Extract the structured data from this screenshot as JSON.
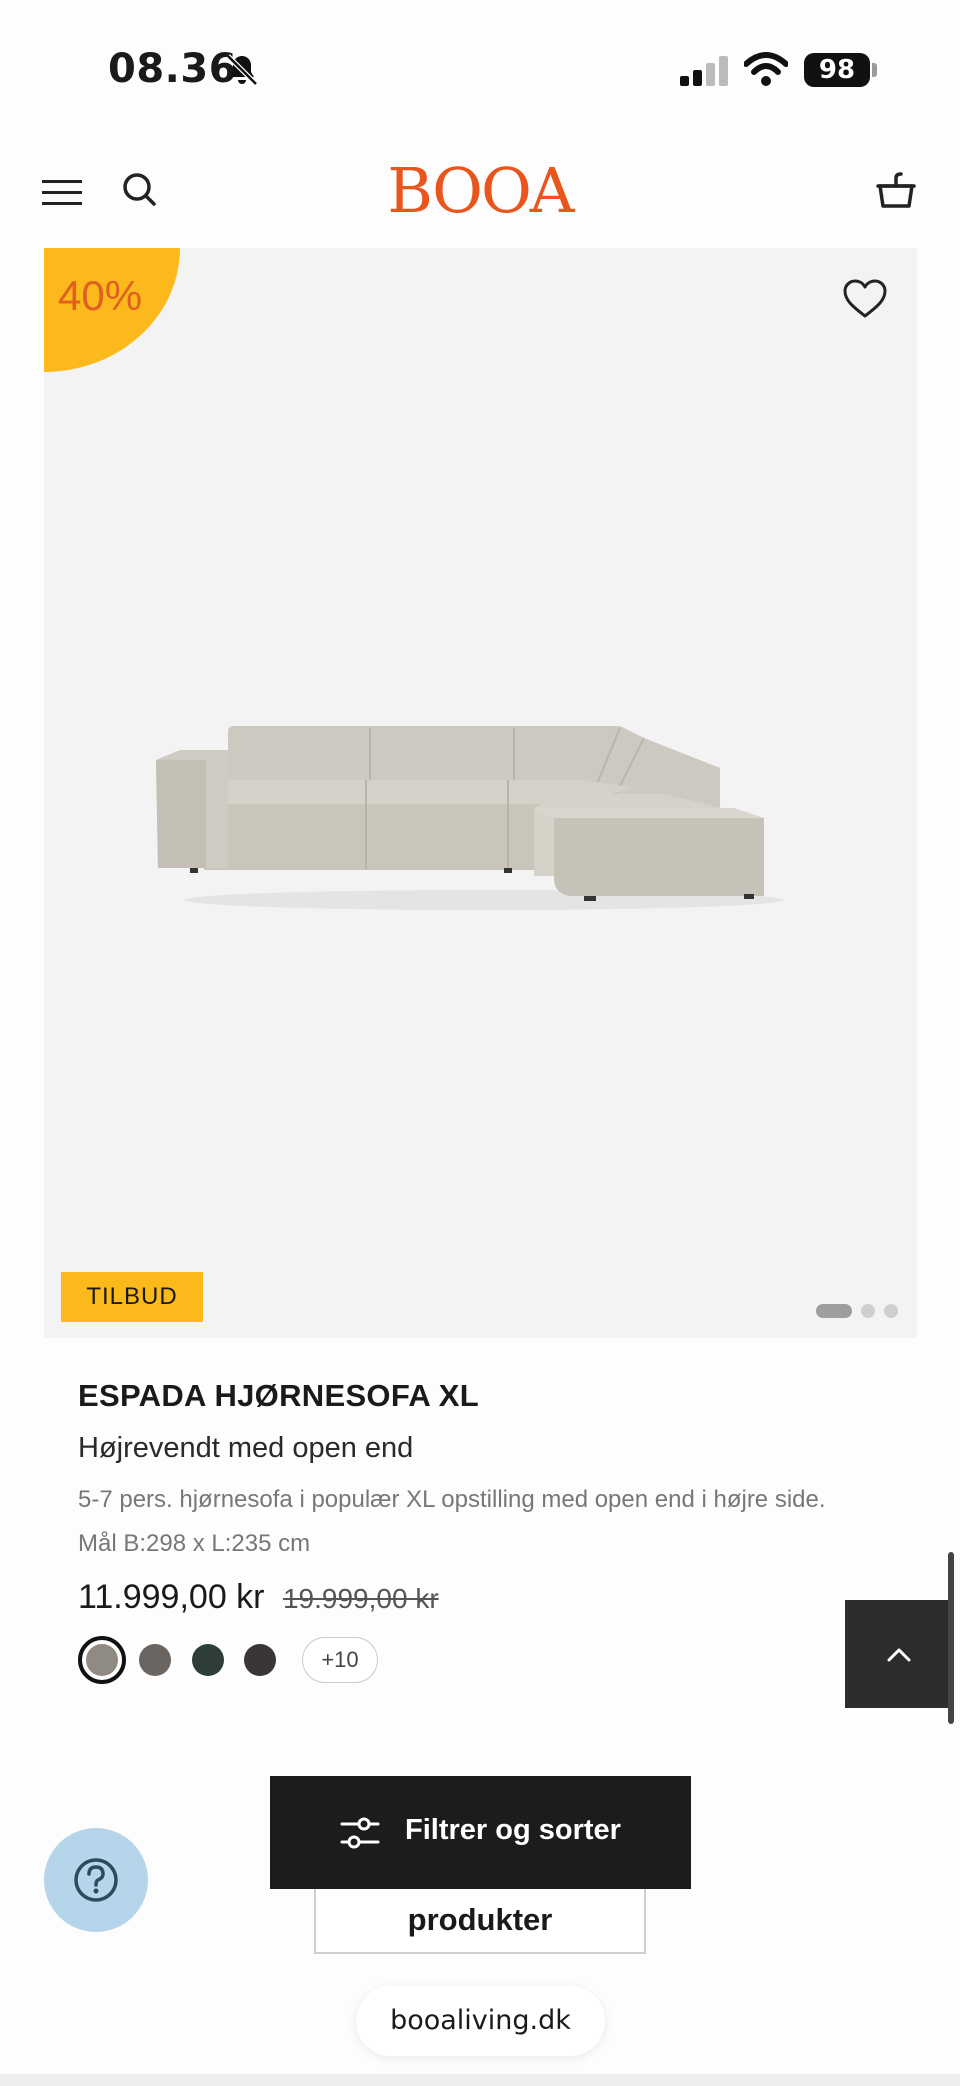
{
  "status_bar": {
    "time": "08.36",
    "battery": "98"
  },
  "header": {
    "logo": "BOOA",
    "brand_color": "#e8561e"
  },
  "product": {
    "discount": "40%",
    "sale_tag": "TILBUD",
    "title": "ESPADA HJØRNESOFA XL",
    "subtitle": "Højrevendt med open end",
    "description": "5-7 pers. hjørnesofa i populær XL opstilling med open end i højre side. Mål B:298 x L:235 cm",
    "price": "11.999,00 kr",
    "old_price": "19.999,00 kr",
    "image_count": 3,
    "active_image": 1,
    "swatches": [
      {
        "color": "#8f8a82",
        "selected": true
      },
      {
        "color": "#6b6561",
        "selected": false
      },
      {
        "color": "#2f3d38",
        "selected": false
      },
      {
        "color": "#3a3536",
        "selected": false
      }
    ],
    "more_colors": "+10"
  },
  "bottom": {
    "filter_label": "Filtrer og sorter",
    "behind_label": "produkter",
    "url": "booaliving.dk"
  },
  "colors": {
    "accent_yellow": "#fbb91c",
    "dark": "#1c1c1c",
    "help_bg": "#b4d5ea"
  }
}
